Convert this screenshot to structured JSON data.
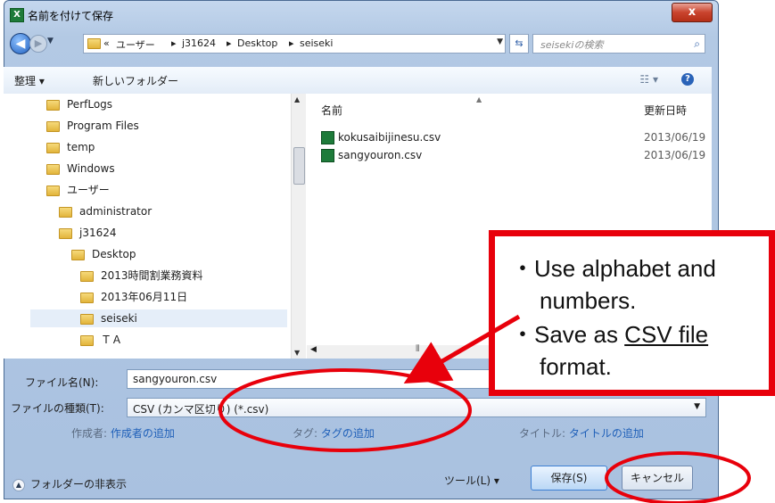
{
  "window": {
    "title": "名前を付けて保存",
    "close_label": "x",
    "app_icon": "X"
  },
  "address": {
    "crumbs": [
      "«",
      "ユーザー",
      "▸",
      "j31624",
      "▸",
      "Desktop",
      "▸",
      "seiseki"
    ],
    "search_placeholder": "seisekiの検索"
  },
  "toolbar": {
    "organize": "整理 ▾",
    "new_folder": "新しいフォルダー",
    "view": "☷ ▾",
    "help": "?"
  },
  "tree": [
    {
      "label": "PerfLogs"
    },
    {
      "label": "Program Files"
    },
    {
      "label": "temp"
    },
    {
      "label": "Windows"
    },
    {
      "label": "ユーザー"
    },
    {
      "label": "administrator"
    },
    {
      "label": "j31624"
    },
    {
      "label": "Desktop"
    },
    {
      "label": "2013時間割業務資料"
    },
    {
      "label": "2013年06月11日"
    },
    {
      "label": "seiseki"
    },
    {
      "label": "ＴＡ"
    }
  ],
  "columns": {
    "name": "名前",
    "date": "更新日時"
  },
  "files": [
    {
      "name": "kokusaibijinesu.csv",
      "date": "2013/06/19"
    },
    {
      "name": "sangyouron.csv",
      "date": "2013/06/19"
    }
  ],
  "form": {
    "filename_label": "ファイル名(N):",
    "filename_value": "sangyouron.csv",
    "filetype_label": "ファイルの種類(T):",
    "filetype_value": "CSV (カンマ区切り) (*.csv)",
    "author_label": "作成者:",
    "author_link": "作成者の追加",
    "tag_label": "タグ:",
    "tag_link": "タグの追加",
    "title_label": "タイトル:",
    "title_link": "タイトルの追加"
  },
  "footer": {
    "hide_folders": "フォルダーの非表示",
    "tools": "ツール(L) ▾",
    "save": "保存(S)",
    "cancel": "キャンセル"
  },
  "callout": {
    "line1": "・Use alphabet and",
    "line2": "numbers.",
    "line3_prefix": "・Save as ",
    "line3_link": "CSV file",
    "line4": "format."
  },
  "colors": {
    "annotation_red": "#e8000b",
    "link_blue": "#1e5fb8"
  }
}
